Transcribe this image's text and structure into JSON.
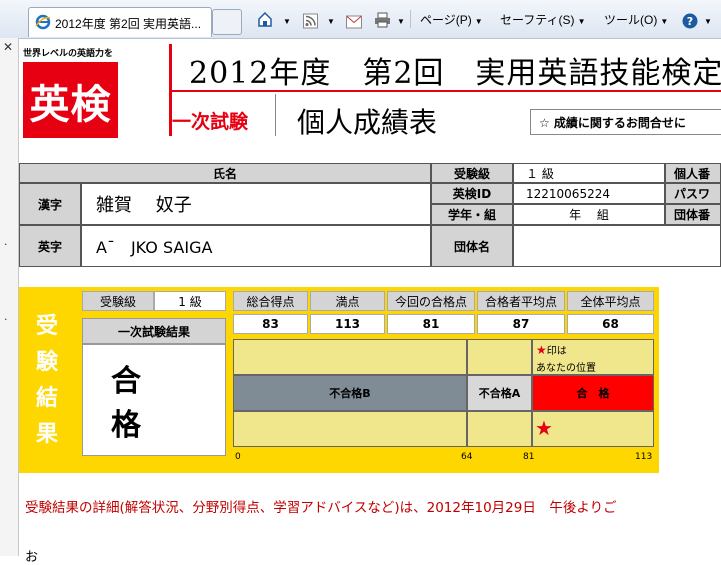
{
  "browser": {
    "tab_title": "2012年度 第2回 実用英語...",
    "menu": {
      "page": "ページ(P)",
      "safety": "セーフティ(S)",
      "tools": "ツール(O)"
    }
  },
  "header": {
    "logo_tagline": "世界レベルの英語力を",
    "logo_text": "英検",
    "title": "2012年度　第2回　実用英語技能検定",
    "exam_stage": "一次試験",
    "report_title": "個人成績表",
    "inquiry": "☆ 成績に関するお問合せに"
  },
  "info": {
    "name_header": "氏名",
    "kanji_label": "漢字",
    "kanji_value": "雑賀　 奴子",
    "roman_label": "英字",
    "roman_value": "A¯　JKO SAIGA",
    "grade_label": "受験級",
    "grade_value": "１ 級",
    "id_label": "英検ID",
    "id_value": "12210065224",
    "year_label": "学年・組",
    "year_value": "年　 組",
    "group_label": "団体名",
    "group_value": "",
    "right_1": "個人番",
    "right_2": "パスワ",
    "right_3": "団体番"
  },
  "results": {
    "side_label": [
      "受",
      "験",
      "結",
      "果"
    ],
    "grade_label": "受験級",
    "grade_value": "1  級",
    "first_result_header": "一次試験結果",
    "first_result": "合格",
    "score_headers": [
      "総合得点",
      "満点",
      "今回の合格点",
      "合格者平均点",
      "全体平均点"
    ],
    "score_values": [
      "83",
      "113",
      "81",
      "87",
      "68"
    ],
    "fail_b": "不合格B",
    "fail_a": "不合格A",
    "pass": "合　格",
    "marker_note_1": "印は",
    "marker_note_2": "あなたの位置",
    "scale": {
      "min": "0",
      "t1": "64",
      "t2": "81",
      "max": "113"
    }
  },
  "note": "受験結果の詳細(解答状況、分野別得点、学習アドバイスなど)は、2012年10月29日　午後よりご",
  "note2": "お"
}
